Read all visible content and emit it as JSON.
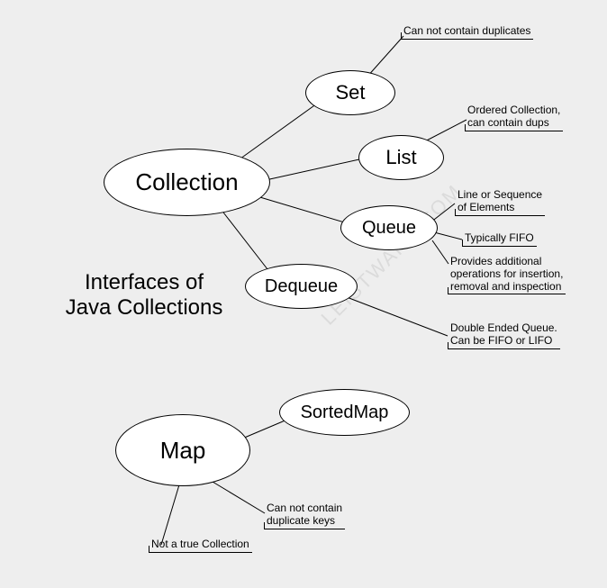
{
  "title_line1": "Interfaces of",
  "title_line2": "Java Collections",
  "nodes": {
    "collection": "Collection",
    "set": "Set",
    "list": "List",
    "queue": "Queue",
    "dequeue": "Dequeue",
    "map": "Map",
    "sortedmap": "SortedMap"
  },
  "notes": {
    "set_note": "Can not contain duplicates",
    "list_note_l1": "Ordered Collection,",
    "list_note_l2": "can contain dups",
    "queue_note1_l1": "Line or Sequence",
    "queue_note1_l2": "of Elements",
    "queue_note2": "Typically FIFO",
    "queue_note3_l1": "Provides additional",
    "queue_note3_l2": "operations for insertion,",
    "queue_note3_l3": "removal and inspection",
    "dequeue_note_l1": "Double Ended Queue.",
    "dequeue_note_l2": "Can be FIFO or LIFO",
    "map_note1_l1": "Can not contain",
    "map_note1_l2": "duplicate keys",
    "map_note2": "Not a true Collection"
  },
  "watermark": "LEISTWARE.COM"
}
